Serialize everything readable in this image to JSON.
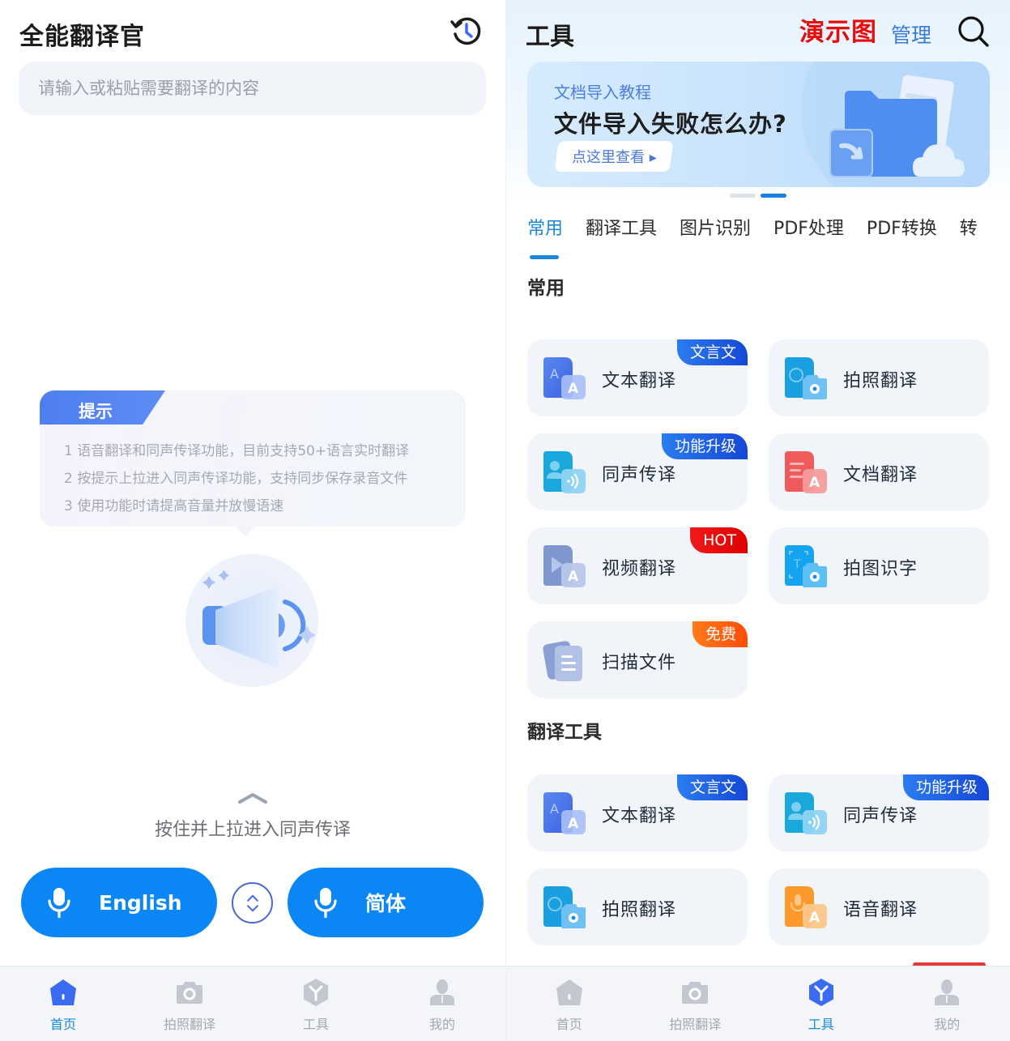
{
  "left": {
    "app_title": "全能翻译官",
    "history_icon": "history-icon",
    "search": {
      "placeholder": "请输入或粘贴需要翻译的内容",
      "value": ""
    },
    "tips": {
      "tag": "提示",
      "items": [
        "1 语音翻译和同声传译功能，目前支持50+语言实时翻译",
        "2 按提示上拉进入同声传译功能，支持同步保存录音文件",
        "3 使用功能时请提高音量并放慢语速"
      ]
    },
    "pull_hint": "按住并上拉进入同声传译",
    "source_lang": "English",
    "target_lang": "简体",
    "nav": [
      {
        "label": "首页",
        "icon": "home-icon",
        "active": true
      },
      {
        "label": "拍照翻译",
        "icon": "camera-icon",
        "active": false
      },
      {
        "label": "工具",
        "icon": "tools-icon",
        "active": false
      },
      {
        "label": "我的",
        "icon": "profile-icon",
        "active": false
      }
    ]
  },
  "right": {
    "title": "工具",
    "watermark": "演示图",
    "manage": "管理",
    "banner": {
      "subtitle": "文档导入教程",
      "title": "文件导入失败怎么办?",
      "button": "点这里查看 ▸",
      "page_index": 2,
      "page_count": 2
    },
    "tabs": [
      {
        "label": "常用",
        "active": true
      },
      {
        "label": "翻译工具",
        "active": false
      },
      {
        "label": "图片识别",
        "active": false
      },
      {
        "label": "PDF处理",
        "active": false
      },
      {
        "label": "PDF转换",
        "active": false
      },
      {
        "label": "转",
        "active": false
      }
    ],
    "sections": [
      {
        "title": "常用",
        "tools": [
          {
            "label": "文本翻译",
            "icon": "text-translate-icon",
            "badge": "文言文",
            "badge_color": "blue"
          },
          {
            "label": "拍照翻译",
            "icon": "photo-translate-icon",
            "badge": null
          },
          {
            "label": "同声传译",
            "icon": "simultaneous-interpretation-icon",
            "badge": "功能升级",
            "badge_color": "blue"
          },
          {
            "label": "文档翻译",
            "icon": "document-translate-icon",
            "badge": null
          },
          {
            "label": "视频翻译",
            "icon": "video-translate-icon",
            "badge": "HOT",
            "badge_color": "red"
          },
          {
            "label": "拍图识字",
            "icon": "image-ocr-icon",
            "badge": null
          },
          {
            "label": "扫描文件",
            "icon": "scan-file-icon",
            "badge": "免费",
            "badge_color": "orange"
          }
        ]
      },
      {
        "title": "翻译工具",
        "tools": [
          {
            "label": "文本翻译",
            "icon": "text-translate-icon",
            "badge": "文言文",
            "badge_color": "blue"
          },
          {
            "label": "同声传译",
            "icon": "simultaneous-interpretation-icon",
            "badge": "功能升级",
            "badge_color": "blue"
          },
          {
            "label": "拍照翻译",
            "icon": "photo-translate-icon",
            "badge": null
          },
          {
            "label": "语音翻译",
            "icon": "voice-translate-icon",
            "badge": null
          }
        ]
      }
    ],
    "nav": [
      {
        "label": "首页",
        "icon": "home-icon",
        "active": false
      },
      {
        "label": "拍照翻译",
        "icon": "camera-icon",
        "active": false
      },
      {
        "label": "工具",
        "icon": "tools-icon",
        "active": true
      },
      {
        "label": "我的",
        "icon": "profile-icon",
        "active": false
      }
    ]
  },
  "colors": {
    "primary": "#0a86f5",
    "active_tab": "#1a86d8",
    "nav_active_icon": "#3b6cf0",
    "nav_inactive": "#c3c8d0",
    "badge_blue": "#1f5fe6",
    "badge_red": "#ee0a0a",
    "badge_orange": "#ff5e0e",
    "watermark_red": "#e60d0d"
  }
}
